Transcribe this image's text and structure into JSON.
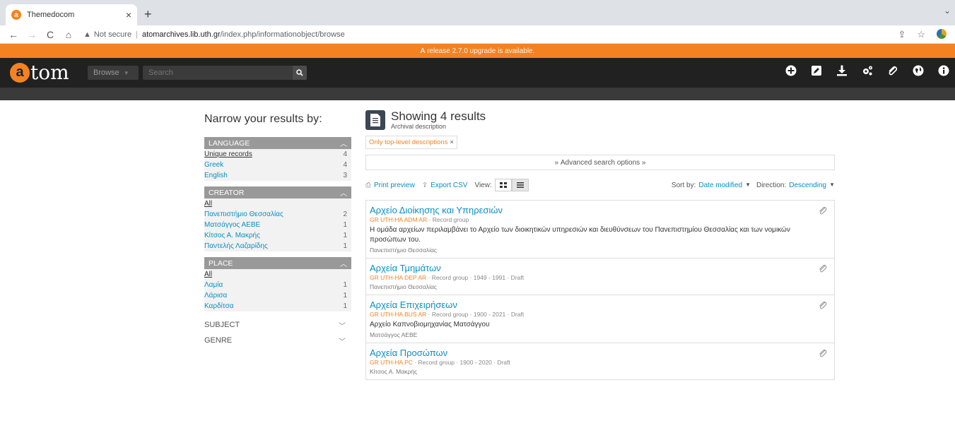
{
  "browser": {
    "tab_title": "Themedocom",
    "tab_close": "×",
    "new_tab": "+",
    "url_warning": "Not secure",
    "url_host": "atomarchives.lib.uth.gr",
    "url_path": "/index.php/informationobject/browse"
  },
  "banner": {
    "prefix": "A ",
    "link": "release 2.7.0 upgrade is available."
  },
  "header": {
    "logo_text": "tom",
    "logo_letter": "a",
    "browse_label": "Browse",
    "search_placeholder": "Search"
  },
  "sidebar": {
    "title": "Narrow your results by:",
    "facets": [
      {
        "name": "LANGUAGE",
        "rows": [
          {
            "label": "Unique records",
            "count": "4"
          },
          {
            "label": "Greek",
            "count": "4"
          },
          {
            "label": "English",
            "count": "3"
          }
        ]
      },
      {
        "name": "CREATOR",
        "rows": [
          {
            "label": "All",
            "count": ""
          },
          {
            "label": "Πανεπιστήμιο Θεσσαλίας",
            "count": "2"
          },
          {
            "label": "Ματσάγγος ΑΕΒΕ",
            "count": "1"
          },
          {
            "label": "Κίτσος Α. Μακρής",
            "count": "1"
          },
          {
            "label": "Παντελής Λαζαρίδης",
            "count": "1"
          }
        ]
      },
      {
        "name": "PLACE",
        "rows": [
          {
            "label": "All",
            "count": ""
          },
          {
            "label": "Λαμία",
            "count": "1"
          },
          {
            "label": "Λάρισα",
            "count": "1"
          },
          {
            "label": "Καρδίτσα",
            "count": "1"
          }
        ]
      }
    ],
    "closed": [
      "SUBJECT",
      "GENRE"
    ]
  },
  "main": {
    "title": "Showing 4 results",
    "subtitle": "Archival description",
    "filter_tag": "Only top-level descriptions",
    "filter_x": "×",
    "advanced": "Advanced search options",
    "print_preview": "Print preview",
    "export_csv": "Export CSV",
    "view_label": "View:",
    "sort_label": "Sort by:",
    "sort_value": "Date modified",
    "direction_label": "Direction:",
    "direction_value": "Descending"
  },
  "results": [
    {
      "title": "Αρχείο Διοίκησης και Υπηρεσιών",
      "ref": "GR UTH-HA ADM AR",
      "meta": " · Record group",
      "desc": "Η ομάδα αρχείων περιλαμβάνει το Αρχείο των διοικητικών υπηρεσιών και διευθύνσεων του Πανεπιστημίου Θεσσαλίας και των νομικών προσώπων του.",
      "creator": "Πανεπιστήμιο Θεσσαλίας"
    },
    {
      "title": "Αρχεία Τμημάτων",
      "ref": "GR UTH-HA DEP AR",
      "meta": " · Record group · 1949 - 1991 · Draft",
      "desc": "",
      "creator": "Πανεπιστήμιο Θεσσαλίας"
    },
    {
      "title": "Αρχεία Επιχειρήσεων",
      "ref": "GR UTH-HA BUS AR",
      "meta": " · Record group · 1900 - 2021 · Draft",
      "desc": "Αρχείο Καπνοβιομηχανίας Ματσάγγου",
      "creator": "Ματσάγγος ΑΕΒΕ"
    },
    {
      "title": "Αρχεία Προσώπων",
      "ref": "GR UTH-HA PC",
      "meta": " · Record group · 1900 - 2020 · Draft",
      "desc": "",
      "creator": "Κίτσος Α. Μακρής"
    }
  ]
}
